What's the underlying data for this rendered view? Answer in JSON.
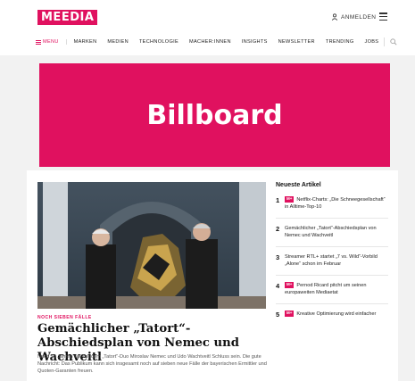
{
  "header": {
    "logo": "MEEDIA",
    "login_label": "ANMELDEN"
  },
  "nav": {
    "menu_label": "MENU",
    "items": [
      "MARKEN",
      "MEDIEN",
      "TECHNOLOGIE",
      "MACHER:INNEN",
      "INSIGHTS",
      "NEWSLETTER",
      "TRENDING",
      "JOBS"
    ]
  },
  "billboard": {
    "label": "Billboard"
  },
  "lead": {
    "kicker": "NOCH SIEBEN FÄLLE",
    "headline": "Gemächlicher „Tatort“-Abschiedsplan von Nemec und Wachveitl",
    "teaser": "Nach 35 Jahren soll bei dem „Tatort“-Duo Miroslav Nemec und Udo Wachtveitl Schluss sein. Die gute Nachricht: Das Publikum kann sich insgesamt noch auf sieben neue Fälle der bayerischen Ermittler und Quoten-Garanten freuen."
  },
  "sidebar": {
    "title": "Neueste Artikel",
    "badge_label": "M+",
    "articles": [
      {
        "num": "1",
        "text": "Netflix-Charts: „Die Schneegesellschaft“ in Alltime-Top-10",
        "badge": true
      },
      {
        "num": "2",
        "text": "Gemächlicher „Tatort“-Abschiedsplan von Nemec und Wachveitl",
        "badge": false
      },
      {
        "num": "3",
        "text": "Streamer RTL+ startet „7 vs. Wild“-Vorbild „Alone“ schon im Februar",
        "badge": false
      },
      {
        "num": "4",
        "text": "Pernod Ricard pitcht um seinen europaweiten Mediaetat",
        "badge": true
      },
      {
        "num": "5",
        "text": "Kreative Optimierung wird einfacher",
        "badge": true
      }
    ]
  },
  "colors": {
    "brand": "#e0115f"
  }
}
